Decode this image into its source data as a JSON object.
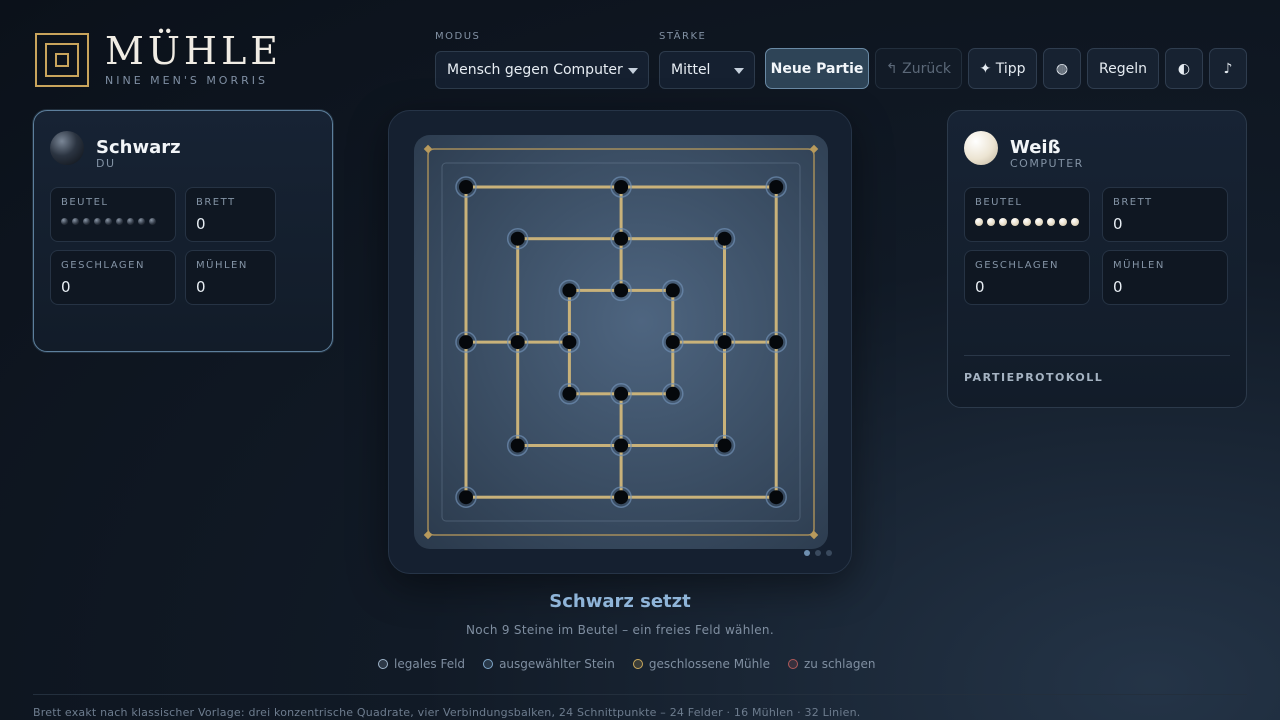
{
  "app": {
    "title": "MÜHLE",
    "subtitle": "NINE MEN'S MORRIS"
  },
  "toolbar": {
    "mode_label": "MODUS",
    "mode_value": "Mensch gegen Computer",
    "strength_label": "STÄRKE",
    "strength_value": "Mittel",
    "new_game": "Neue Partie",
    "undo": "↰ Zurück",
    "hint": "✦ Tipp",
    "icon_button_glyph": "◍",
    "rules": "Regeln",
    "theme_glyph": "◐",
    "sound_glyph": "♪"
  },
  "players": {
    "black": {
      "name": "Schwarz",
      "role": "DU",
      "bag_label": "BEUTEL",
      "bag_count": 9,
      "board_label": "BRETT",
      "board_value": "0",
      "captured_label": "GESCHLAGEN",
      "captured_value": "0",
      "mills_label": "MÜHLEN",
      "mills_value": "0"
    },
    "white": {
      "name": "Weiß",
      "role": "COMPUTER",
      "bag_label": "BEUTEL",
      "bag_count": 9,
      "board_label": "BRETT",
      "board_value": "0",
      "captured_label": "GESCHLAGEN",
      "captured_value": "0",
      "mills_label": "MÜHLEN",
      "mills_value": "0",
      "protocol_label": "PARTIEPROTOKOLL"
    }
  },
  "board": {
    "grid_points": [
      [
        0,
        0
      ],
      [
        3,
        0
      ],
      [
        6,
        0
      ],
      [
        1,
        1
      ],
      [
        3,
        1
      ],
      [
        5,
        1
      ],
      [
        2,
        2
      ],
      [
        3,
        2
      ],
      [
        4,
        2
      ],
      [
        0,
        3
      ],
      [
        1,
        3
      ],
      [
        2,
        3
      ],
      [
        4,
        3
      ],
      [
        5,
        3
      ],
      [
        6,
        3
      ],
      [
        2,
        4
      ],
      [
        3,
        4
      ],
      [
        4,
        4
      ],
      [
        1,
        5
      ],
      [
        3,
        5
      ],
      [
        5,
        5
      ],
      [
        0,
        6
      ],
      [
        3,
        6
      ],
      [
        6,
        6
      ]
    ],
    "occupied": [],
    "colors": {
      "line": "#c9b27a",
      "frame": "#b89a5c",
      "hole": "#05080c",
      "legal_ring": "#6f8fb3"
    },
    "page_indicator": {
      "total": 3,
      "active": 1
    }
  },
  "status": {
    "title": "Schwarz setzt",
    "subtitle": "Noch 9 Steine im Beutel – ein freies Feld wählen."
  },
  "legend": [
    {
      "label": "legales Feld",
      "color": "#9fb4c9"
    },
    {
      "label": "ausgewählter Stein",
      "color": "#7fa6c8"
    },
    {
      "label": "geschlossene Mühle",
      "color": "#c9a85c"
    },
    {
      "label": "zu schlagen",
      "color": "#b05a5a"
    }
  ],
  "footer": "Brett exakt nach klassischer Vorlage: drei konzentrische Quadrate, vier Verbindungsbalken, 24 Schnittpunkte – 24 Felder · 16 Mühlen · 32 Linien."
}
